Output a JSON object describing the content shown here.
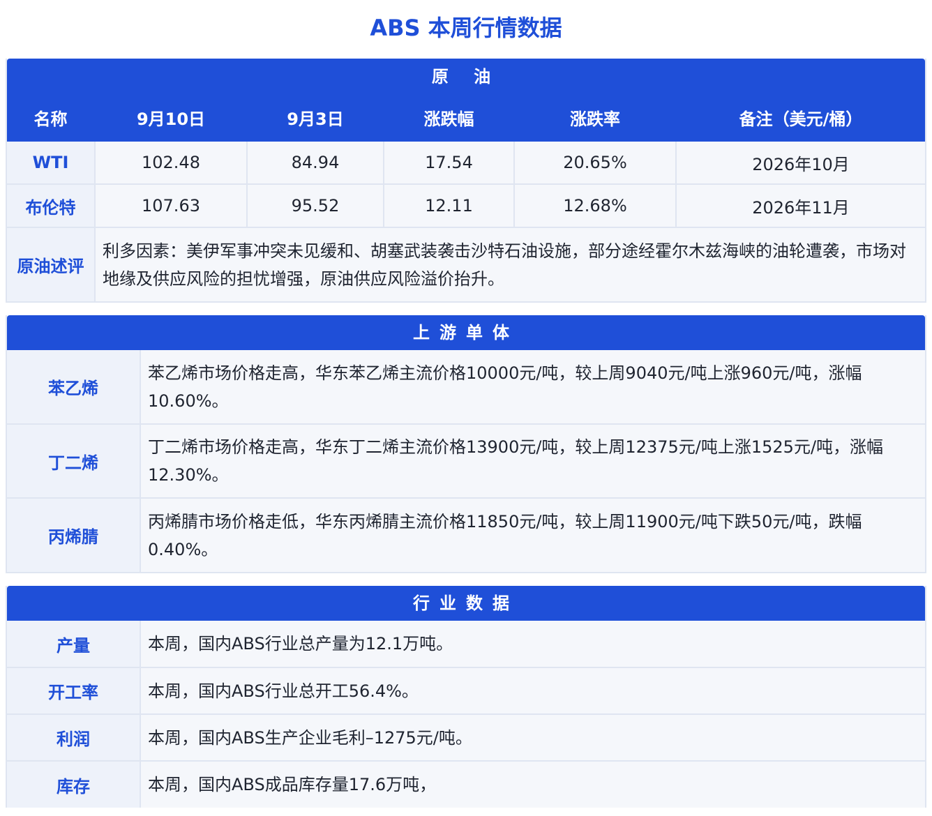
{
  "title": "ABS 本周行情数据",
  "colors": {
    "accent": "#1f4fd8",
    "label_bg": "#eef2fa",
    "cell_bg": "#f5f7fb",
    "border": "#dfe5f1"
  },
  "crude": {
    "header": "原  油",
    "columns": [
      "名称",
      "9月10日",
      "9月3日",
      "涨跌幅",
      "涨跌率",
      "备注（美元/桶）"
    ],
    "rows": [
      {
        "name": "WTI",
        "cur": "102.48",
        "prev": "84.94",
        "change": "17.54",
        "rate": "20.65%",
        "note": "2026年10月"
      },
      {
        "name": "布伦特",
        "cur": "107.63",
        "prev": "95.52",
        "change": "12.11",
        "rate": "12.68%",
        "note": "2026年11月"
      }
    ],
    "comment_label": "原油述评",
    "comment": "利多因素：美伊军事冲突未见缓和、胡塞武装袭击沙特石油设施，部分途经霍尔木兹海峡的油轮遭袭，市场对地缘及供应风险的担忧增强，原油供应风险溢价抬升。"
  },
  "upstream": {
    "header": "上游单体",
    "rows": [
      {
        "name": "苯乙烯",
        "text": "苯乙烯市场价格走高，华东苯乙烯主流价格10000元/吨，较上周9040元/吨上涨960元/吨，涨幅10.60%。"
      },
      {
        "name": "丁二烯",
        "text": "丁二烯市场价格走高，华东丁二烯主流价格13900元/吨，较上周12375元/吨上涨1525元/吨，涨幅12.30%。"
      },
      {
        "name": "丙烯腈",
        "text": "丙烯腈市场价格走低，华东丙烯腈主流价格11850元/吨，较上周11900元/吨下跌50元/吨，跌幅0.40%。"
      }
    ]
  },
  "industry": {
    "header": "行业数据",
    "rows": [
      {
        "name": "产量",
        "text": "本周，国内ABS行业总产量为12.1万吨。"
      },
      {
        "name": "开工率",
        "text": "本周，国内ABS行业总开工56.4%。"
      },
      {
        "name": "利润",
        "text": "本周，国内ABS生产企业毛利–1275元/吨。"
      },
      {
        "name": "库存",
        "text": "本周，国内ABS成品库存量17.6万吨，"
      }
    ]
  }
}
